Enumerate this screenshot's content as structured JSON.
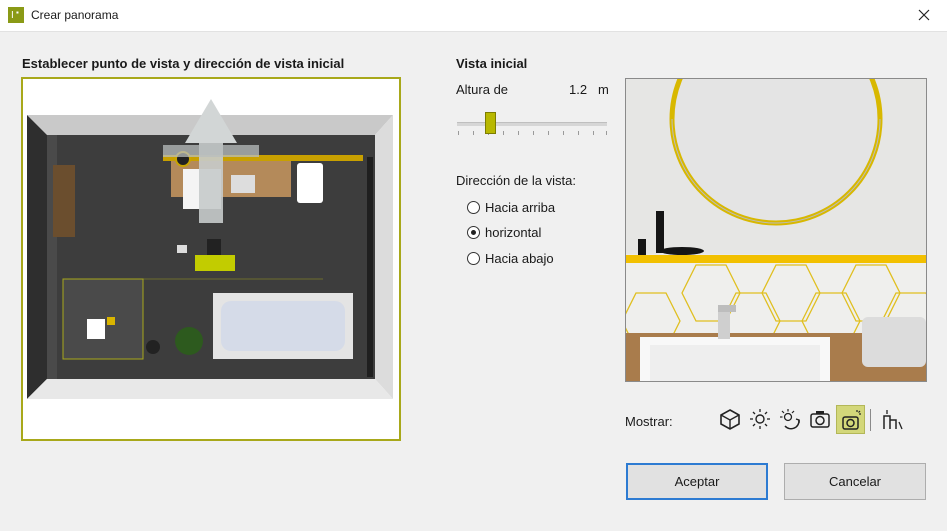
{
  "window": {
    "title": "Crear panorama",
    "accent": "#8a9a16"
  },
  "left": {
    "title": "Establecer punto de vista y dirección de vista inicial"
  },
  "right": {
    "title": "Vista inicial",
    "height_label": "Altura de",
    "height_value": "1.2",
    "height_unit": "m",
    "direction_label": "Dirección de la vista:",
    "directions": [
      {
        "label": "Hacia arriba",
        "selected": false
      },
      {
        "label": "horizontal",
        "selected": true
      },
      {
        "label": "Hacia abajo",
        "selected": false
      }
    ]
  },
  "show": {
    "label": "Mostrar:",
    "tools": [
      "cube-view-icon",
      "light-icon",
      "light-settings-icon",
      "camera-icon",
      "camera-light-icon",
      "path-icon"
    ],
    "active_tool": "camera-light-icon"
  },
  "buttons": {
    "accept": "Aceptar",
    "cancel": "Cancelar"
  }
}
